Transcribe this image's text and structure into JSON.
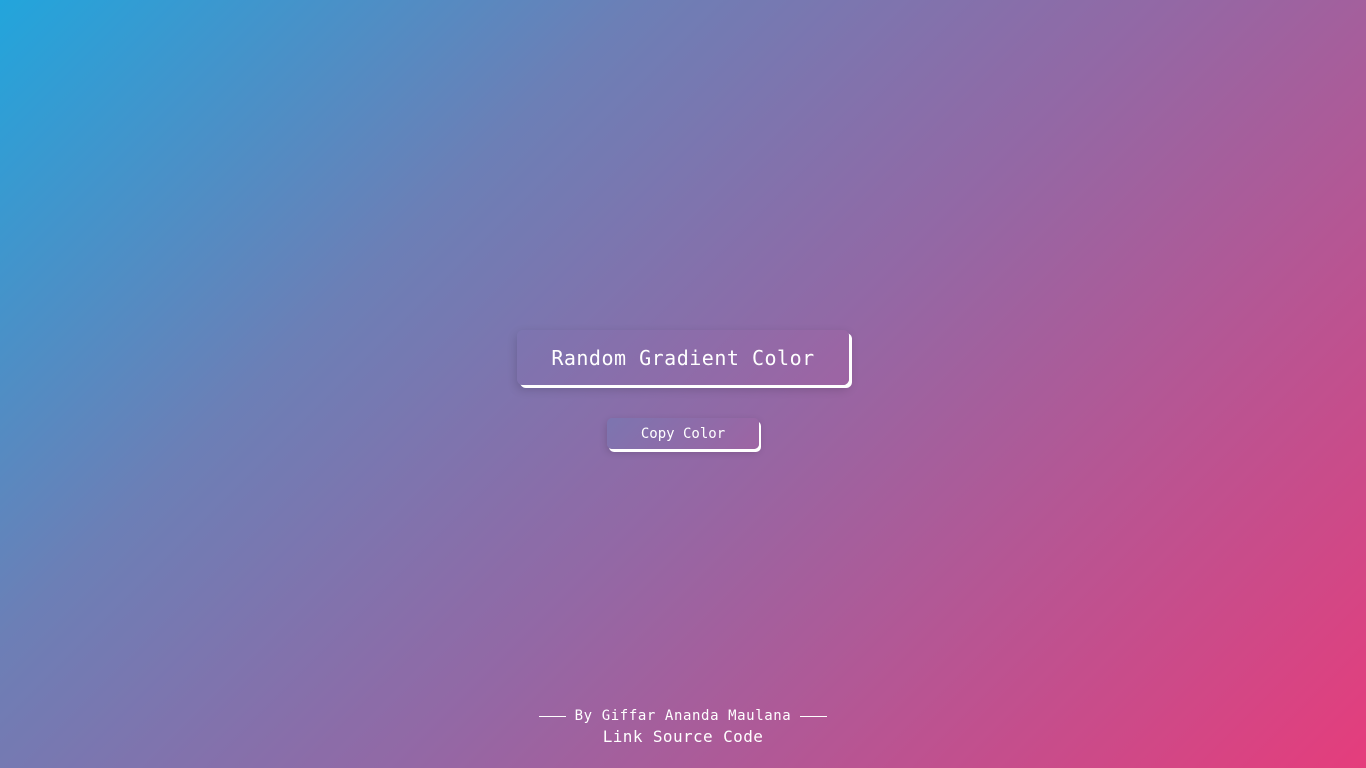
{
  "main": {
    "generate_label": "Random Gradient Color",
    "copy_label": "Copy Color"
  },
  "footer": {
    "credit": "By Giffar Ananda Maulana",
    "link_label": "Link Source Code"
  },
  "colors": {
    "gradient_start": "#22a5dc",
    "gradient_end": "#e53d7c",
    "text": "#ffffff"
  }
}
